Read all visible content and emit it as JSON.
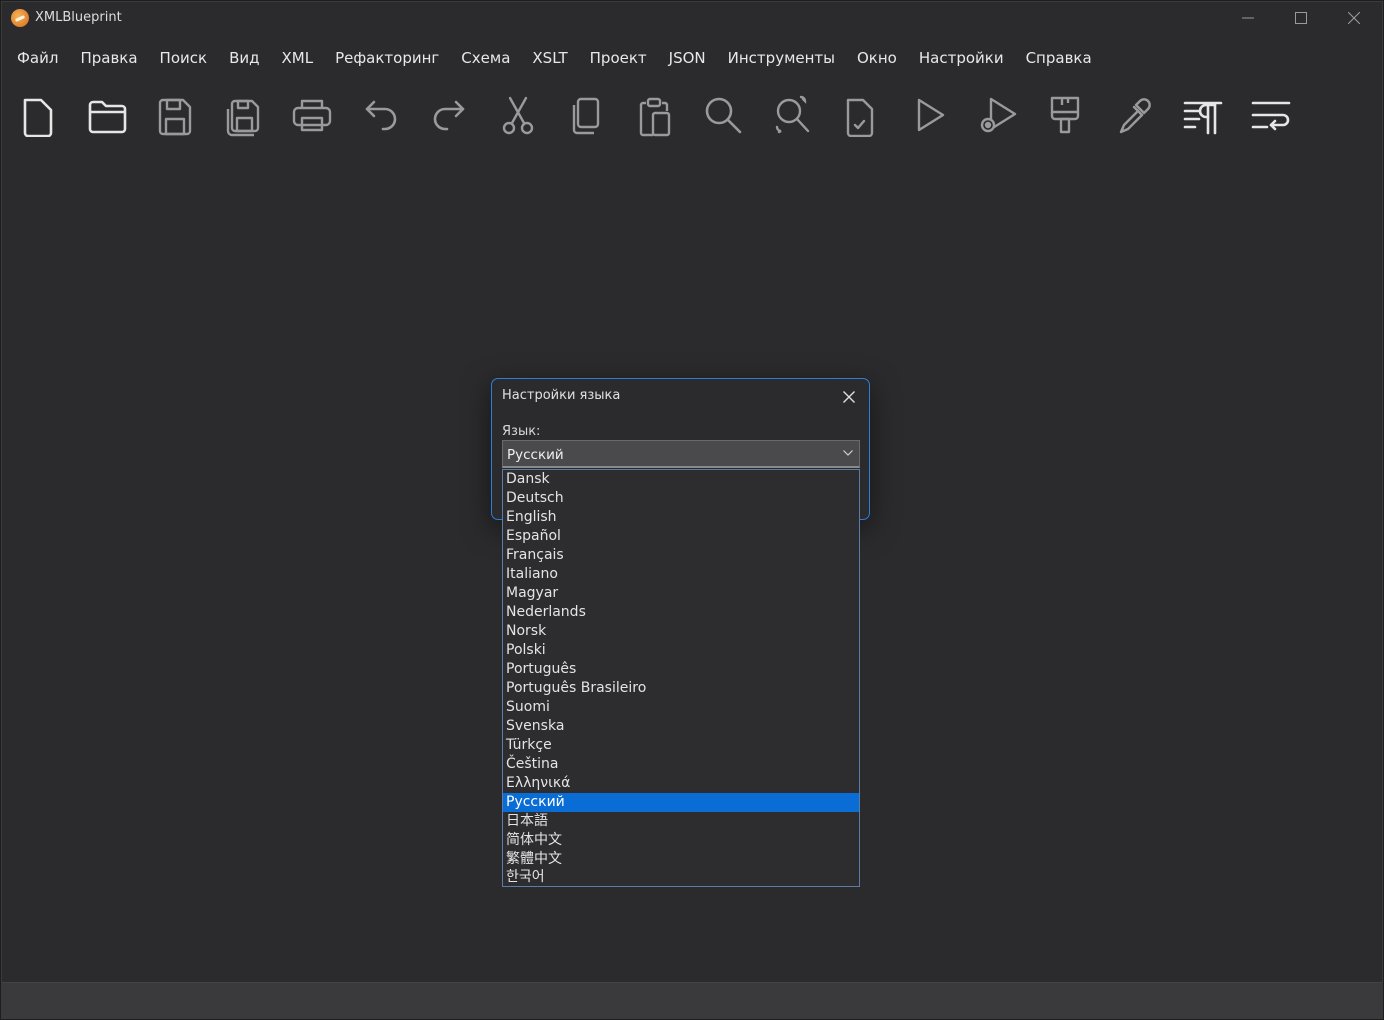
{
  "window": {
    "title": "XMLBlueprint"
  },
  "menu": [
    "Файл",
    "Правка",
    "Поиск",
    "Вид",
    "XML",
    "Рефакторинг",
    "Схема",
    "XSLT",
    "Проект",
    "JSON",
    "Инструменты",
    "Окно",
    "Настройки",
    "Справка"
  ],
  "toolbar": {
    "icons": [
      "new-file-icon",
      "open-folder-icon",
      "save-icon",
      "save-all-icon",
      "print-icon",
      "undo-icon",
      "redo-icon",
      "cut-icon",
      "copy-icon",
      "paste-icon",
      "find-icon",
      "replace-icon",
      "validate-icon",
      "run-icon",
      "run-config-icon",
      "brush-icon",
      "dropper-icon",
      "pretty-print-icon",
      "word-wrap-icon"
    ]
  },
  "dialog": {
    "title": "Настройки языка",
    "language_label": "Язык:",
    "selected_language": "Русский",
    "languages": [
      "Dansk",
      "Deutsch",
      "English",
      "Español",
      "Français",
      "Italiano",
      "Magyar",
      "Nederlands",
      "Norsk",
      "Polski",
      "Português",
      "Português Brasileiro",
      "Suomi",
      "Svenska",
      "Türkçe",
      "Čeština",
      "Ελληνικά",
      "Русский",
      "日本語",
      "简体中文",
      "繁體中文",
      "한국어"
    ]
  },
  "colors": {
    "accent": "#0a6dd6",
    "background": "#2b2b2d",
    "dialog_border": "#2b7fd8"
  }
}
